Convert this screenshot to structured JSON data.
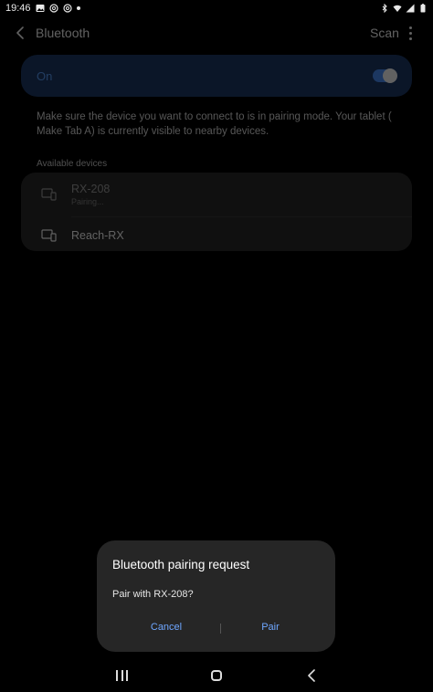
{
  "status_bar": {
    "time": "19:46",
    "left_icons": [
      "image-icon",
      "at-sign-icon",
      "at-sign-icon",
      "dot-icon"
    ],
    "right_icons": [
      "bluetooth-icon",
      "wifi-icon",
      "signal-icon",
      "battery-icon"
    ]
  },
  "app_bar": {
    "title": "Bluetooth",
    "scan_label": "Scan"
  },
  "toggle": {
    "label": "On",
    "state": "on"
  },
  "info_text": "Make sure the device you want to connect to is in pairing mode. Your tablet ( Make Tab A) is currently visible to nearby devices.",
  "available_devices": {
    "header": "Available devices",
    "items": [
      {
        "name": "RX-208",
        "status": "Pairing..."
      },
      {
        "name": "Reach-RX",
        "status": ""
      }
    ]
  },
  "dialog": {
    "title": "Bluetooth pairing request",
    "message": "Pair with RX-208?",
    "cancel_label": "Cancel",
    "pair_label": "Pair"
  },
  "colors": {
    "accent": "#4a90ff",
    "toggle_card": "#1d3a6a",
    "dialog_bg": "#262626",
    "dialog_button": "#6ea6ff"
  }
}
